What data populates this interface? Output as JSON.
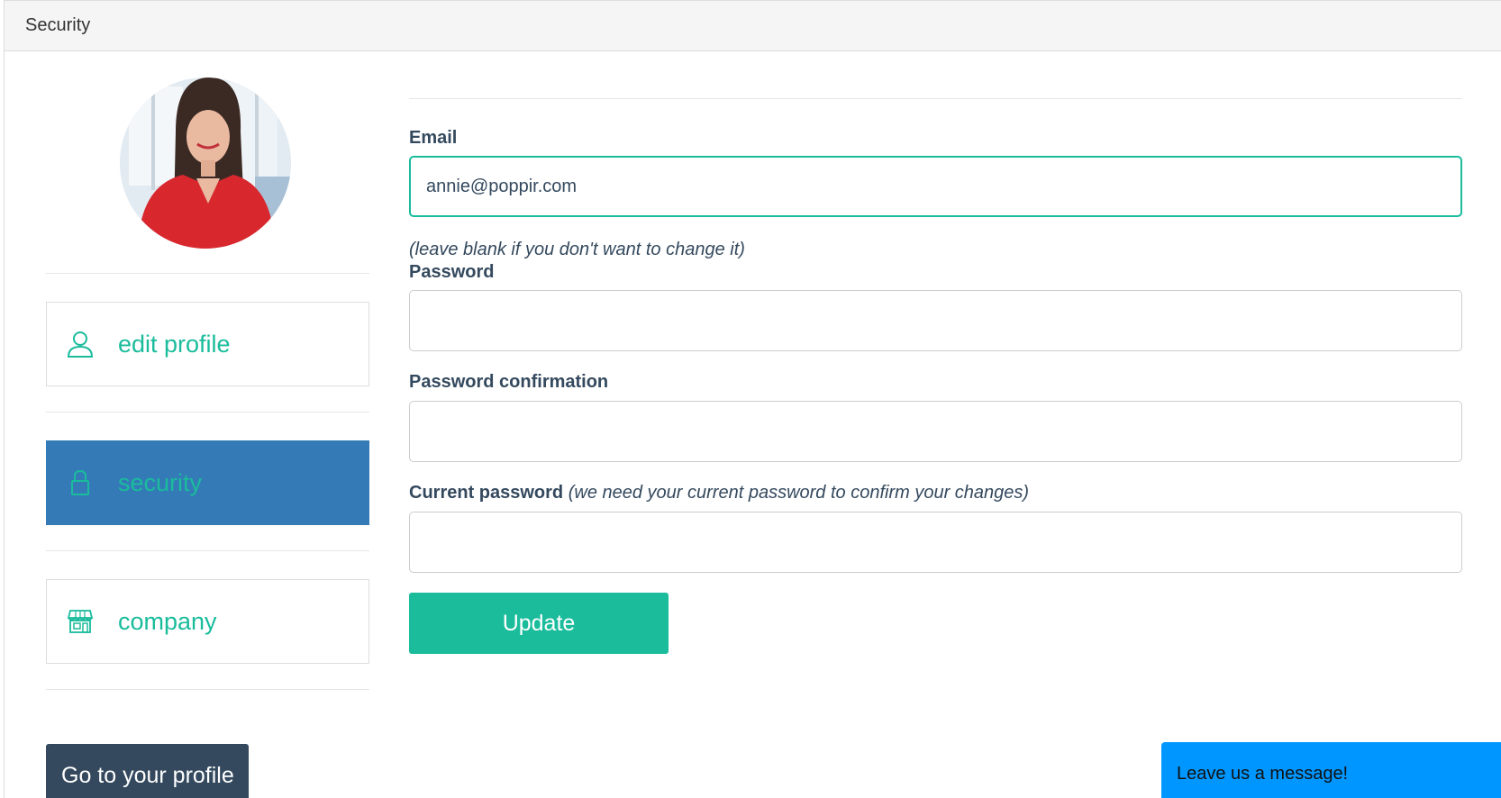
{
  "panel": {
    "title": "Security"
  },
  "sidebar": {
    "items": [
      {
        "label": "edit profile",
        "icon": "user-icon"
      },
      {
        "label": "security",
        "icon": "lock-icon",
        "active": true
      },
      {
        "label": "company",
        "icon": "store-icon"
      }
    ],
    "profile_button": "Go to your profile"
  },
  "form": {
    "email": {
      "label": "Email",
      "value": "annie@poppir.com"
    },
    "blank_note": "(leave blank if you don't want to change it)",
    "password": {
      "label": "Password",
      "value": ""
    },
    "password_confirmation": {
      "label": "Password confirmation",
      "value": ""
    },
    "current_password": {
      "label": "Current password",
      "hint": "(we need your current password to confirm your changes)",
      "value": ""
    },
    "submit": "Update"
  },
  "chat": {
    "label": "Leave us a message!"
  },
  "colors": {
    "accent": "#1abc9c",
    "active_nav": "#337ab7",
    "dark_button": "#34495e",
    "chat_widget": "#0096ff"
  }
}
